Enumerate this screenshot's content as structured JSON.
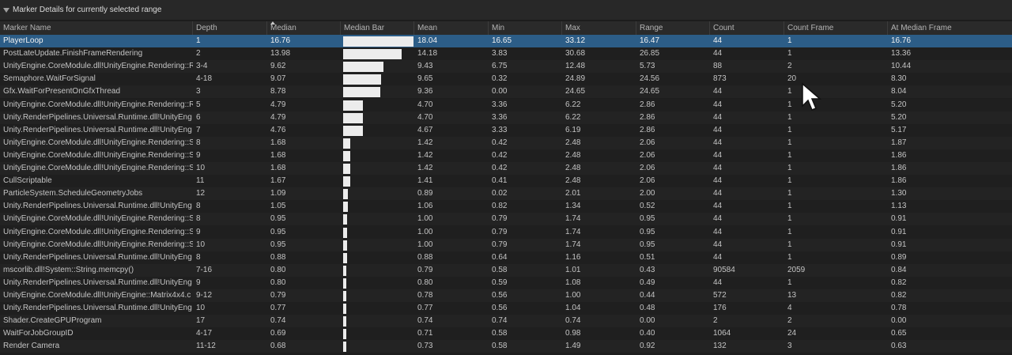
{
  "panel": {
    "title": "Marker Details for currently selected range"
  },
  "columns": {
    "marker_name": "Marker Name",
    "depth": "Depth",
    "median": "Median",
    "median_bar": "Median Bar",
    "mean": "Mean",
    "min": "Min",
    "max": "Max",
    "range": "Range",
    "count": "Count",
    "count_frame": "Count Frame",
    "at_median_frame": "At Median Frame"
  },
  "sort": {
    "column": "Median",
    "direction": "descending"
  },
  "median_bar_max": 16.76,
  "colors": {
    "selected_row": "#2c5d87",
    "bar": "#ececec"
  },
  "rows": [
    {
      "name": "PlayerLoop",
      "depth": "1",
      "median": "16.76",
      "mean": "18.04",
      "min": "16.65",
      "max": "33.12",
      "range": "16.47",
      "count": "44",
      "count_frame": "1",
      "at_median": "16.76"
    },
    {
      "name": "PostLateUpdate.FinishFrameRendering",
      "depth": "2",
      "median": "13.98",
      "mean": "14.18",
      "min": "3.83",
      "max": "30.68",
      "range": "26.85",
      "count": "44",
      "count_frame": "1",
      "at_median": "13.36"
    },
    {
      "name": "UnityEngine.CoreModule.dll!UnityEngine.Rendering::R",
      "depth": "3-4",
      "median": "9.62",
      "mean": "9.43",
      "min": "6.75",
      "max": "12.48",
      "range": "5.73",
      "count": "88",
      "count_frame": "2",
      "at_median": "10.44"
    },
    {
      "name": "Semaphore.WaitForSignal",
      "depth": "4-18",
      "median": "9.07",
      "mean": "9.65",
      "min": "0.32",
      "max": "24.89",
      "range": "24.56",
      "count": "873",
      "count_frame": "20",
      "at_median": "8.30"
    },
    {
      "name": "Gfx.WaitForPresentOnGfxThread",
      "depth": "3",
      "median": "8.78",
      "mean": "9.36",
      "min": "0.00",
      "max": "24.65",
      "range": "24.65",
      "count": "44",
      "count_frame": "1",
      "at_median": "8.04"
    },
    {
      "name": "UnityEngine.CoreModule.dll!UnityEngine.Rendering::R",
      "depth": "5",
      "median": "4.79",
      "mean": "4.70",
      "min": "3.36",
      "max": "6.22",
      "range": "2.86",
      "count": "44",
      "count_frame": "1",
      "at_median": "5.20"
    },
    {
      "name": "Unity.RenderPipelines.Universal.Runtime.dll!UnityEng",
      "depth": "6",
      "median": "4.79",
      "mean": "4.70",
      "min": "3.36",
      "max": "6.22",
      "range": "2.86",
      "count": "44",
      "count_frame": "1",
      "at_median": "5.20"
    },
    {
      "name": "Unity.RenderPipelines.Universal.Runtime.dll!UnityEng",
      "depth": "7",
      "median": "4.76",
      "mean": "4.67",
      "min": "3.33",
      "max": "6.19",
      "range": "2.86",
      "count": "44",
      "count_frame": "1",
      "at_median": "5.17"
    },
    {
      "name": "UnityEngine.CoreModule.dll!UnityEngine.Rendering::S",
      "depth": "8",
      "median": "1.68",
      "mean": "1.42",
      "min": "0.42",
      "max": "2.48",
      "range": "2.06",
      "count": "44",
      "count_frame": "1",
      "at_median": "1.87"
    },
    {
      "name": "UnityEngine.CoreModule.dll!UnityEngine.Rendering::S",
      "depth": "9",
      "median": "1.68",
      "mean": "1.42",
      "min": "0.42",
      "max": "2.48",
      "range": "2.06",
      "count": "44",
      "count_frame": "1",
      "at_median": "1.86"
    },
    {
      "name": "UnityEngine.CoreModule.dll!UnityEngine.Rendering::S",
      "depth": "10",
      "median": "1.68",
      "mean": "1.42",
      "min": "0.42",
      "max": "2.48",
      "range": "2.06",
      "count": "44",
      "count_frame": "1",
      "at_median": "1.86"
    },
    {
      "name": "CullScriptable",
      "depth": "11",
      "median": "1.67",
      "mean": "1.41",
      "min": "0.41",
      "max": "2.48",
      "range": "2.06",
      "count": "44",
      "count_frame": "1",
      "at_median": "1.86"
    },
    {
      "name": "ParticleSystem.ScheduleGeometryJobs",
      "depth": "12",
      "median": "1.09",
      "mean": "0.89",
      "min": "0.02",
      "max": "2.01",
      "range": "2.00",
      "count": "44",
      "count_frame": "1",
      "at_median": "1.30"
    },
    {
      "name": "Unity.RenderPipelines.Universal.Runtime.dll!UnityEng",
      "depth": "8",
      "median": "1.05",
      "mean": "1.06",
      "min": "0.82",
      "max": "1.34",
      "range": "0.52",
      "count": "44",
      "count_frame": "1",
      "at_median": "1.13"
    },
    {
      "name": "UnityEngine.CoreModule.dll!UnityEngine.Rendering::S",
      "depth": "8",
      "median": "0.95",
      "mean": "1.00",
      "min": "0.79",
      "max": "1.74",
      "range": "0.95",
      "count": "44",
      "count_frame": "1",
      "at_median": "0.91"
    },
    {
      "name": "UnityEngine.CoreModule.dll!UnityEngine.Rendering::S",
      "depth": "9",
      "median": "0.95",
      "mean": "1.00",
      "min": "0.79",
      "max": "1.74",
      "range": "0.95",
      "count": "44",
      "count_frame": "1",
      "at_median": "0.91"
    },
    {
      "name": "UnityEngine.CoreModule.dll!UnityEngine.Rendering::S",
      "depth": "10",
      "median": "0.95",
      "mean": "1.00",
      "min": "0.79",
      "max": "1.74",
      "range": "0.95",
      "count": "44",
      "count_frame": "1",
      "at_median": "0.91"
    },
    {
      "name": "Unity.RenderPipelines.Universal.Runtime.dll!UnityEng",
      "depth": "8",
      "median": "0.88",
      "mean": "0.88",
      "min": "0.64",
      "max": "1.16",
      "range": "0.51",
      "count": "44",
      "count_frame": "1",
      "at_median": "0.89"
    },
    {
      "name": "mscorlib.dll!System::String.memcpy()",
      "depth": "7-16",
      "median": "0.80",
      "mean": "0.79",
      "min": "0.58",
      "max": "1.01",
      "range": "0.43",
      "count": "90584",
      "count_frame": "2059",
      "at_median": "0.84"
    },
    {
      "name": "Unity.RenderPipelines.Universal.Runtime.dll!UnityEng",
      "depth": "9",
      "median": "0.80",
      "mean": "0.80",
      "min": "0.59",
      "max": "1.08",
      "range": "0.49",
      "count": "44",
      "count_frame": "1",
      "at_median": "0.82"
    },
    {
      "name": "UnityEngine.CoreModule.dll!UnityEngine::Matrix4x4.c",
      "depth": "9-12",
      "median": "0.79",
      "mean": "0.78",
      "min": "0.56",
      "max": "1.00",
      "range": "0.44",
      "count": "572",
      "count_frame": "13",
      "at_median": "0.82"
    },
    {
      "name": "Unity.RenderPipelines.Universal.Runtime.dll!UnityEng",
      "depth": "10",
      "median": "0.77",
      "mean": "0.77",
      "min": "0.56",
      "max": "1.04",
      "range": "0.48",
      "count": "176",
      "count_frame": "4",
      "at_median": "0.78"
    },
    {
      "name": "Shader.CreateGPUProgram",
      "depth": "17",
      "median": "0.74",
      "mean": "0.74",
      "min": "0.74",
      "max": "0.74",
      "range": "0.00",
      "count": "2",
      "count_frame": "2",
      "at_median": "0.00"
    },
    {
      "name": "WaitForJobGroupID",
      "depth": "4-17",
      "median": "0.69",
      "mean": "0.71",
      "min": "0.58",
      "max": "0.98",
      "range": "0.40",
      "count": "1064",
      "count_frame": "24",
      "at_median": "0.65"
    },
    {
      "name": "Render Camera",
      "depth": "11-12",
      "median": "0.68",
      "mean": "0.73",
      "min": "0.58",
      "max": "1.49",
      "range": "0.92",
      "count": "132",
      "count_frame": "3",
      "at_median": "0.63"
    }
  ]
}
